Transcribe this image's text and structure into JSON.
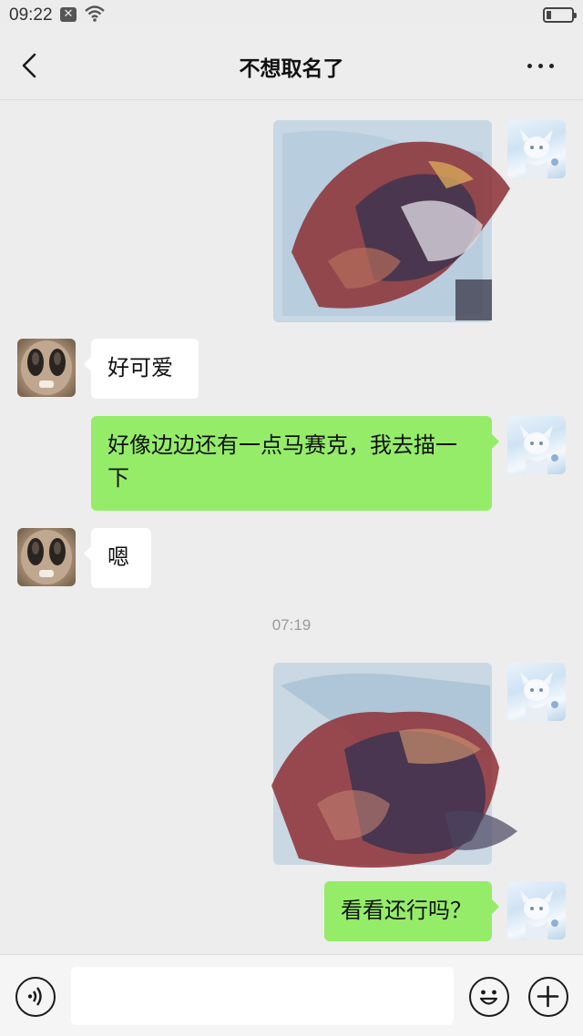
{
  "status_bar": {
    "time": "09:22",
    "notification_icon": "x-notification-icon",
    "wifi_icon": "wifi-icon",
    "battery_level": 0.2
  },
  "nav": {
    "title": "不想取名了",
    "back_icon": "chevron-left-icon",
    "more_icon": "more-dots-icon"
  },
  "messages": [
    {
      "side": "right",
      "type": "image",
      "description_icon": "sketch-image"
    },
    {
      "side": "left",
      "type": "text",
      "text": "好可爱"
    },
    {
      "side": "right",
      "type": "text",
      "text": "好像边边还有一点马赛克，我去描一下"
    },
    {
      "side": "left",
      "type": "text",
      "text": "嗯"
    },
    {
      "side": "right",
      "type": "image",
      "description_icon": "sketch-image"
    },
    {
      "side": "right",
      "type": "text",
      "text": "看看还行吗？"
    }
  ],
  "timestamp": "07:19",
  "input_bar": {
    "voice_icon": "voice-icon",
    "emoji_icon": "emoji-icon",
    "plus_icon": "plus-icon",
    "placeholder": ""
  },
  "colors": {
    "background": "#ededed",
    "bubble_green": "#95ec69",
    "bubble_white": "#ffffff"
  }
}
